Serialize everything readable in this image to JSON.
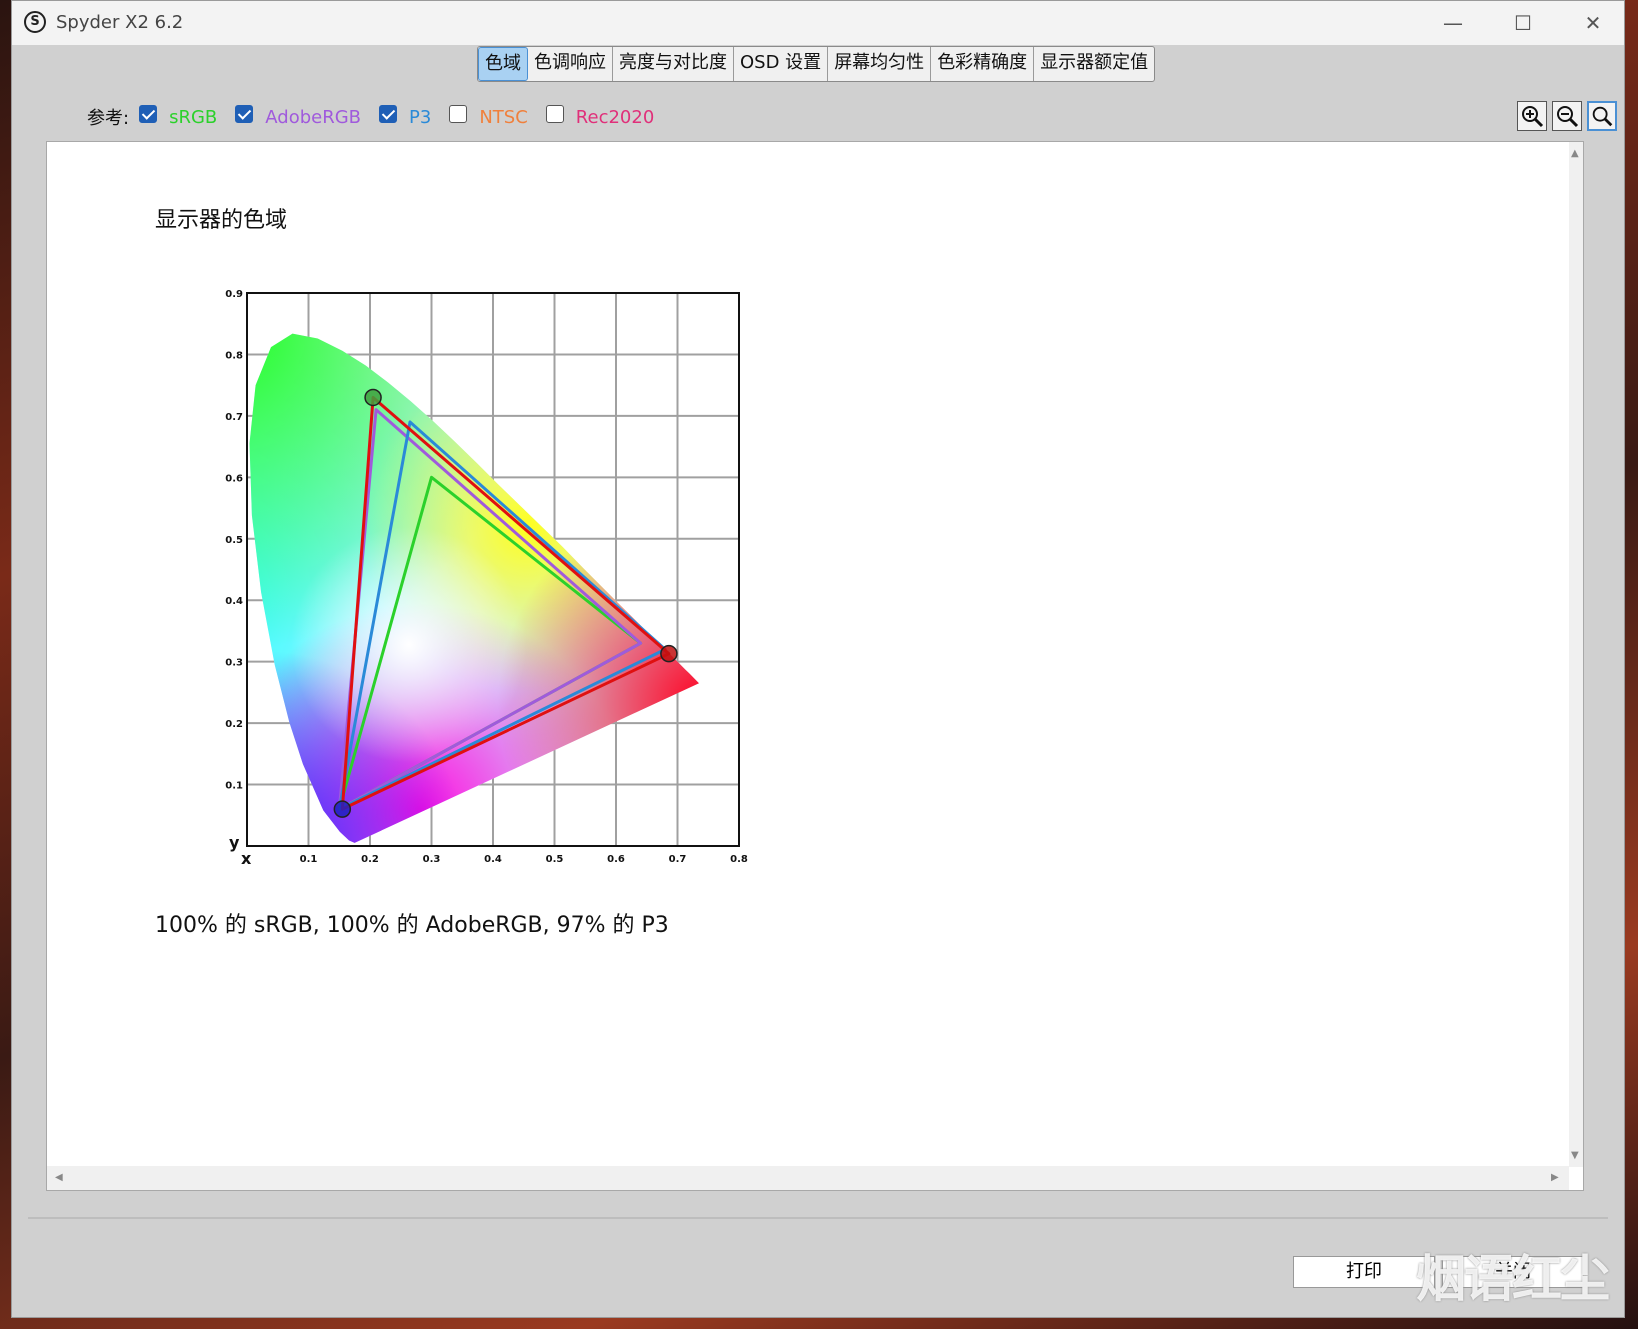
{
  "window": {
    "title": "Spyder X2 6.2",
    "min_glyph": "—",
    "max_glyph": "☐",
    "close_glyph": "✕"
  },
  "tabs": [
    {
      "label": "色域",
      "active": true
    },
    {
      "label": "色调响应"
    },
    {
      "label": "亮度与对比度"
    },
    {
      "label": "OSD 设置"
    },
    {
      "label": "屏幕均匀性"
    },
    {
      "label": "色彩精确度"
    },
    {
      "label": "显示器额定值"
    }
  ],
  "reference": {
    "label": "参考:",
    "items": [
      {
        "label": "sRGB",
        "checked": true,
        "color": "#2bd12b"
      },
      {
        "label": "AdobeRGB",
        "checked": true,
        "color": "#a05adc"
      },
      {
        "label": "P3",
        "checked": true,
        "color": "#2a8ad8"
      },
      {
        "label": "NTSC",
        "checked": false,
        "color": "#f0803c"
      },
      {
        "label": "Rec2020",
        "checked": false,
        "color": "#e0307a"
      }
    ]
  },
  "zoom_tools": [
    "zoom-in-icon",
    "zoom-out-icon",
    "zoom-fit-icon"
  ],
  "content": {
    "title": "显示器的色域",
    "coverage": "100% 的 sRGB, 100% 的 AdobeRGB, 97% 的 P3"
  },
  "chart_data": {
    "type": "scatter",
    "xlabel": "x",
    "ylabel": "y",
    "xlim": [
      0,
      0.8
    ],
    "ylim": [
      0,
      0.9
    ],
    "x_ticks": [
      "0.1",
      "0.2",
      "0.3",
      "0.4",
      "0.5",
      "0.6",
      "0.7",
      "0.8"
    ],
    "y_ticks": [
      "0.1",
      "0.2",
      "0.3",
      "0.4",
      "0.5",
      "0.6",
      "0.7",
      "0.8",
      "0.9"
    ],
    "grid": true,
    "locus": [
      [
        0.175,
        0.005
      ],
      [
        0.166,
        0.009
      ],
      [
        0.151,
        0.023
      ],
      [
        0.124,
        0.058
      ],
      [
        0.091,
        0.133
      ],
      [
        0.069,
        0.201
      ],
      [
        0.045,
        0.295
      ],
      [
        0.023,
        0.413
      ],
      [
        0.008,
        0.538
      ],
      [
        0.004,
        0.655
      ],
      [
        0.014,
        0.75
      ],
      [
        0.039,
        0.812
      ],
      [
        0.074,
        0.834
      ],
      [
        0.115,
        0.826
      ],
      [
        0.155,
        0.806
      ],
      [
        0.193,
        0.782
      ],
      [
        0.23,
        0.754
      ],
      [
        0.266,
        0.724
      ],
      [
        0.302,
        0.692
      ],
      [
        0.337,
        0.659
      ],
      [
        0.373,
        0.624
      ],
      [
        0.408,
        0.589
      ],
      [
        0.444,
        0.554
      ],
      [
        0.479,
        0.52
      ],
      [
        0.513,
        0.487
      ],
      [
        0.547,
        0.452
      ],
      [
        0.575,
        0.424
      ],
      [
        0.603,
        0.396
      ],
      [
        0.627,
        0.372
      ],
      [
        0.648,
        0.351
      ],
      [
        0.666,
        0.334
      ],
      [
        0.68,
        0.32
      ],
      [
        0.692,
        0.308
      ],
      [
        0.701,
        0.299
      ],
      [
        0.708,
        0.292
      ],
      [
        0.713,
        0.287
      ],
      [
        0.719,
        0.281
      ],
      [
        0.735,
        0.265
      ]
    ],
    "series": [
      {
        "name": "sRGB",
        "color": "#2bd12b",
        "points": [
          [
            0.64,
            0.33
          ],
          [
            0.3,
            0.6
          ],
          [
            0.15,
            0.06
          ]
        ]
      },
      {
        "name": "AdobeRGB",
        "color": "#a05adc",
        "points": [
          [
            0.64,
            0.33
          ],
          [
            0.21,
            0.71
          ],
          [
            0.15,
            0.06
          ]
        ]
      },
      {
        "name": "P3",
        "color": "#2a8ad8",
        "points": [
          [
            0.68,
            0.32
          ],
          [
            0.265,
            0.69
          ],
          [
            0.15,
            0.06
          ]
        ]
      },
      {
        "name": "显示器",
        "color": "#e01010",
        "points": [
          [
            0.686,
            0.313
          ],
          [
            0.205,
            0.73
          ],
          [
            0.155,
            0.06
          ]
        ]
      }
    ]
  },
  "buttons": {
    "print": "打印",
    "close": "关闭"
  },
  "watermark": "烟语红尘"
}
